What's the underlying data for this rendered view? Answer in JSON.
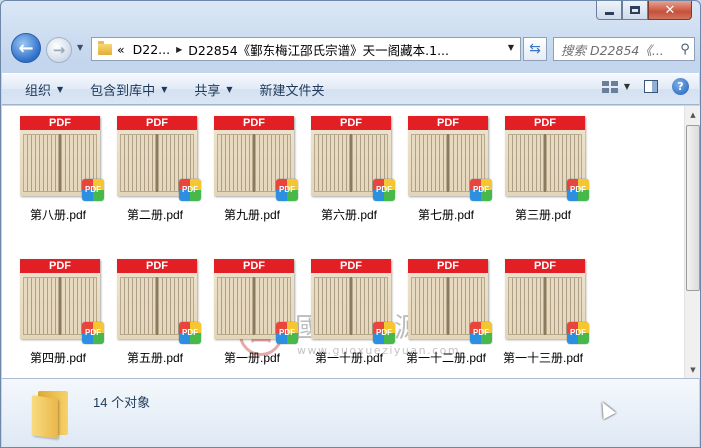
{
  "window": {
    "minimize_icon": "minimize-icon",
    "maximize_icon": "maximize-icon",
    "close_glyph": "✕"
  },
  "nav": {
    "back_glyph": "←",
    "forward_glyph": "→",
    "address": {
      "overflow": "«",
      "crumb1": "D22...",
      "crumb2": "D22854《鄞东梅江邵氏宗谱》天一阁藏本.1..."
    },
    "search_placeholder": "搜索 D22854《..."
  },
  "toolbar": {
    "organize": "组织",
    "include_library": "包含到库中",
    "share": "共享",
    "new_folder": "新建文件夹"
  },
  "file_badge": "PDF",
  "files": [
    {
      "name": "第八册.pdf"
    },
    {
      "name": "第二册.pdf"
    },
    {
      "name": "第九册.pdf"
    },
    {
      "name": "第六册.pdf"
    },
    {
      "name": "第七册.pdf"
    },
    {
      "name": "第三册.pdf"
    },
    {
      "name": "第四册.pdf"
    },
    {
      "name": "第五册.pdf"
    },
    {
      "name": "第一册.pdf"
    },
    {
      "name": "第一十册.pdf"
    },
    {
      "name": "第一十二册.pdf"
    },
    {
      "name": "第一十三册.pdf"
    }
  ],
  "watermark": {
    "seal": "國",
    "title": "國學資源網",
    "url": "www.guoxueziyuan.com"
  },
  "details": {
    "count_text": "14 个对象"
  }
}
